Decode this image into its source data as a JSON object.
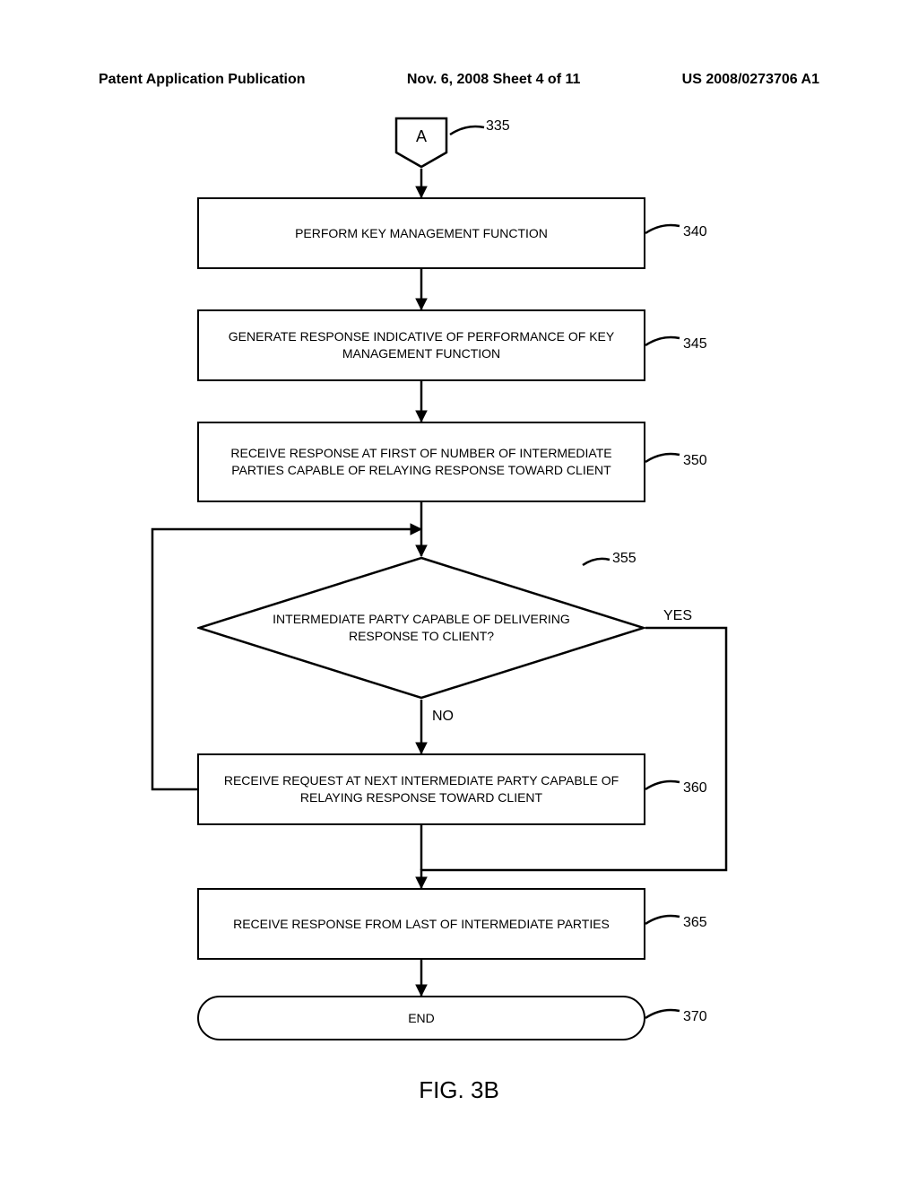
{
  "header": {
    "left": "Patent Application Publication",
    "center": "Nov. 6, 2008  Sheet 4 of 11",
    "right": "US 2008/0273706 A1"
  },
  "nodes": {
    "connA": {
      "text": "A",
      "ref": "335"
    },
    "n340": {
      "text": "PERFORM KEY MANAGEMENT FUNCTION",
      "ref": "340"
    },
    "n345": {
      "text": "GENERATE RESPONSE INDICATIVE OF PERFORMANCE OF KEY MANAGEMENT FUNCTION",
      "ref": "345"
    },
    "n350": {
      "text": "RECEIVE RESPONSE AT FIRST OF NUMBER OF INTERMEDIATE PARTIES CAPABLE OF RELAYING RESPONSE TOWARD CLIENT",
      "ref": "350"
    },
    "n355": {
      "text": "INTERMEDIATE PARTY CAPABLE OF DELIVERING RESPONSE TO CLIENT?",
      "ref": "355",
      "yes": "YES",
      "no": "NO"
    },
    "n360": {
      "text": "RECEIVE REQUEST AT NEXT INTERMEDIATE PARTY CAPABLE OF RELAYING RESPONSE TOWARD CLIENT",
      "ref": "360"
    },
    "n365": {
      "text": "RECEIVE RESPONSE FROM LAST OF INTERMEDIATE PARTIES",
      "ref": "365"
    },
    "end": {
      "text": "END",
      "ref": "370"
    }
  },
  "figure": "FIG. 3B"
}
